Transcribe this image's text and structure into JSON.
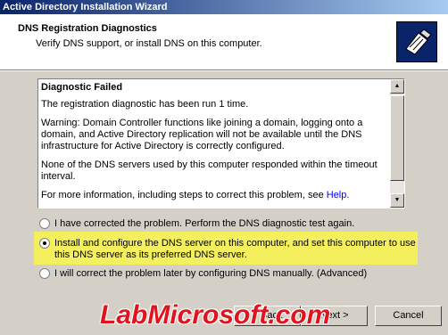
{
  "window": {
    "title": "Active Directory Installation Wizard"
  },
  "header": {
    "title": "DNS Registration Diagnostics",
    "subtitle": "Verify DNS support, or install DNS on this computer.",
    "icon": "dns-wizard-icon"
  },
  "diagnostics": {
    "heading": "Diagnostic Failed",
    "p1": "The registration diagnostic has been run 1 time.",
    "p2": "Warning: Domain Controller functions like joining a domain, logging onto a domain, and Active Directory replication will not be available until the DNS infrastructure for Active Directory is correctly configured.",
    "p3": "None of the DNS servers used by this computer responded within the timeout interval.",
    "p4_prefix": "For more information, including steps to correct this problem, see ",
    "p4_link": "Help."
  },
  "options": [
    {
      "label": "I have corrected the problem. Perform the DNS diagnostic test again.",
      "checked": false
    },
    {
      "label": "Install and configure the DNS server on this computer, and set this computer to use",
      "label2": "this DNS server as its preferred DNS server.",
      "checked": true
    },
    {
      "label": "I will correct the problem later by configuring DNS manually. (Advanced)",
      "checked": false
    }
  ],
  "buttons": {
    "back": "< Back",
    "next": "Next >",
    "cancel": "Cancel"
  },
  "watermark": "LabMicrosoft.com",
  "colors": {
    "highlight": "#f4ef5c",
    "watermark": "#e0141e",
    "titlebar": "#0a246a"
  }
}
